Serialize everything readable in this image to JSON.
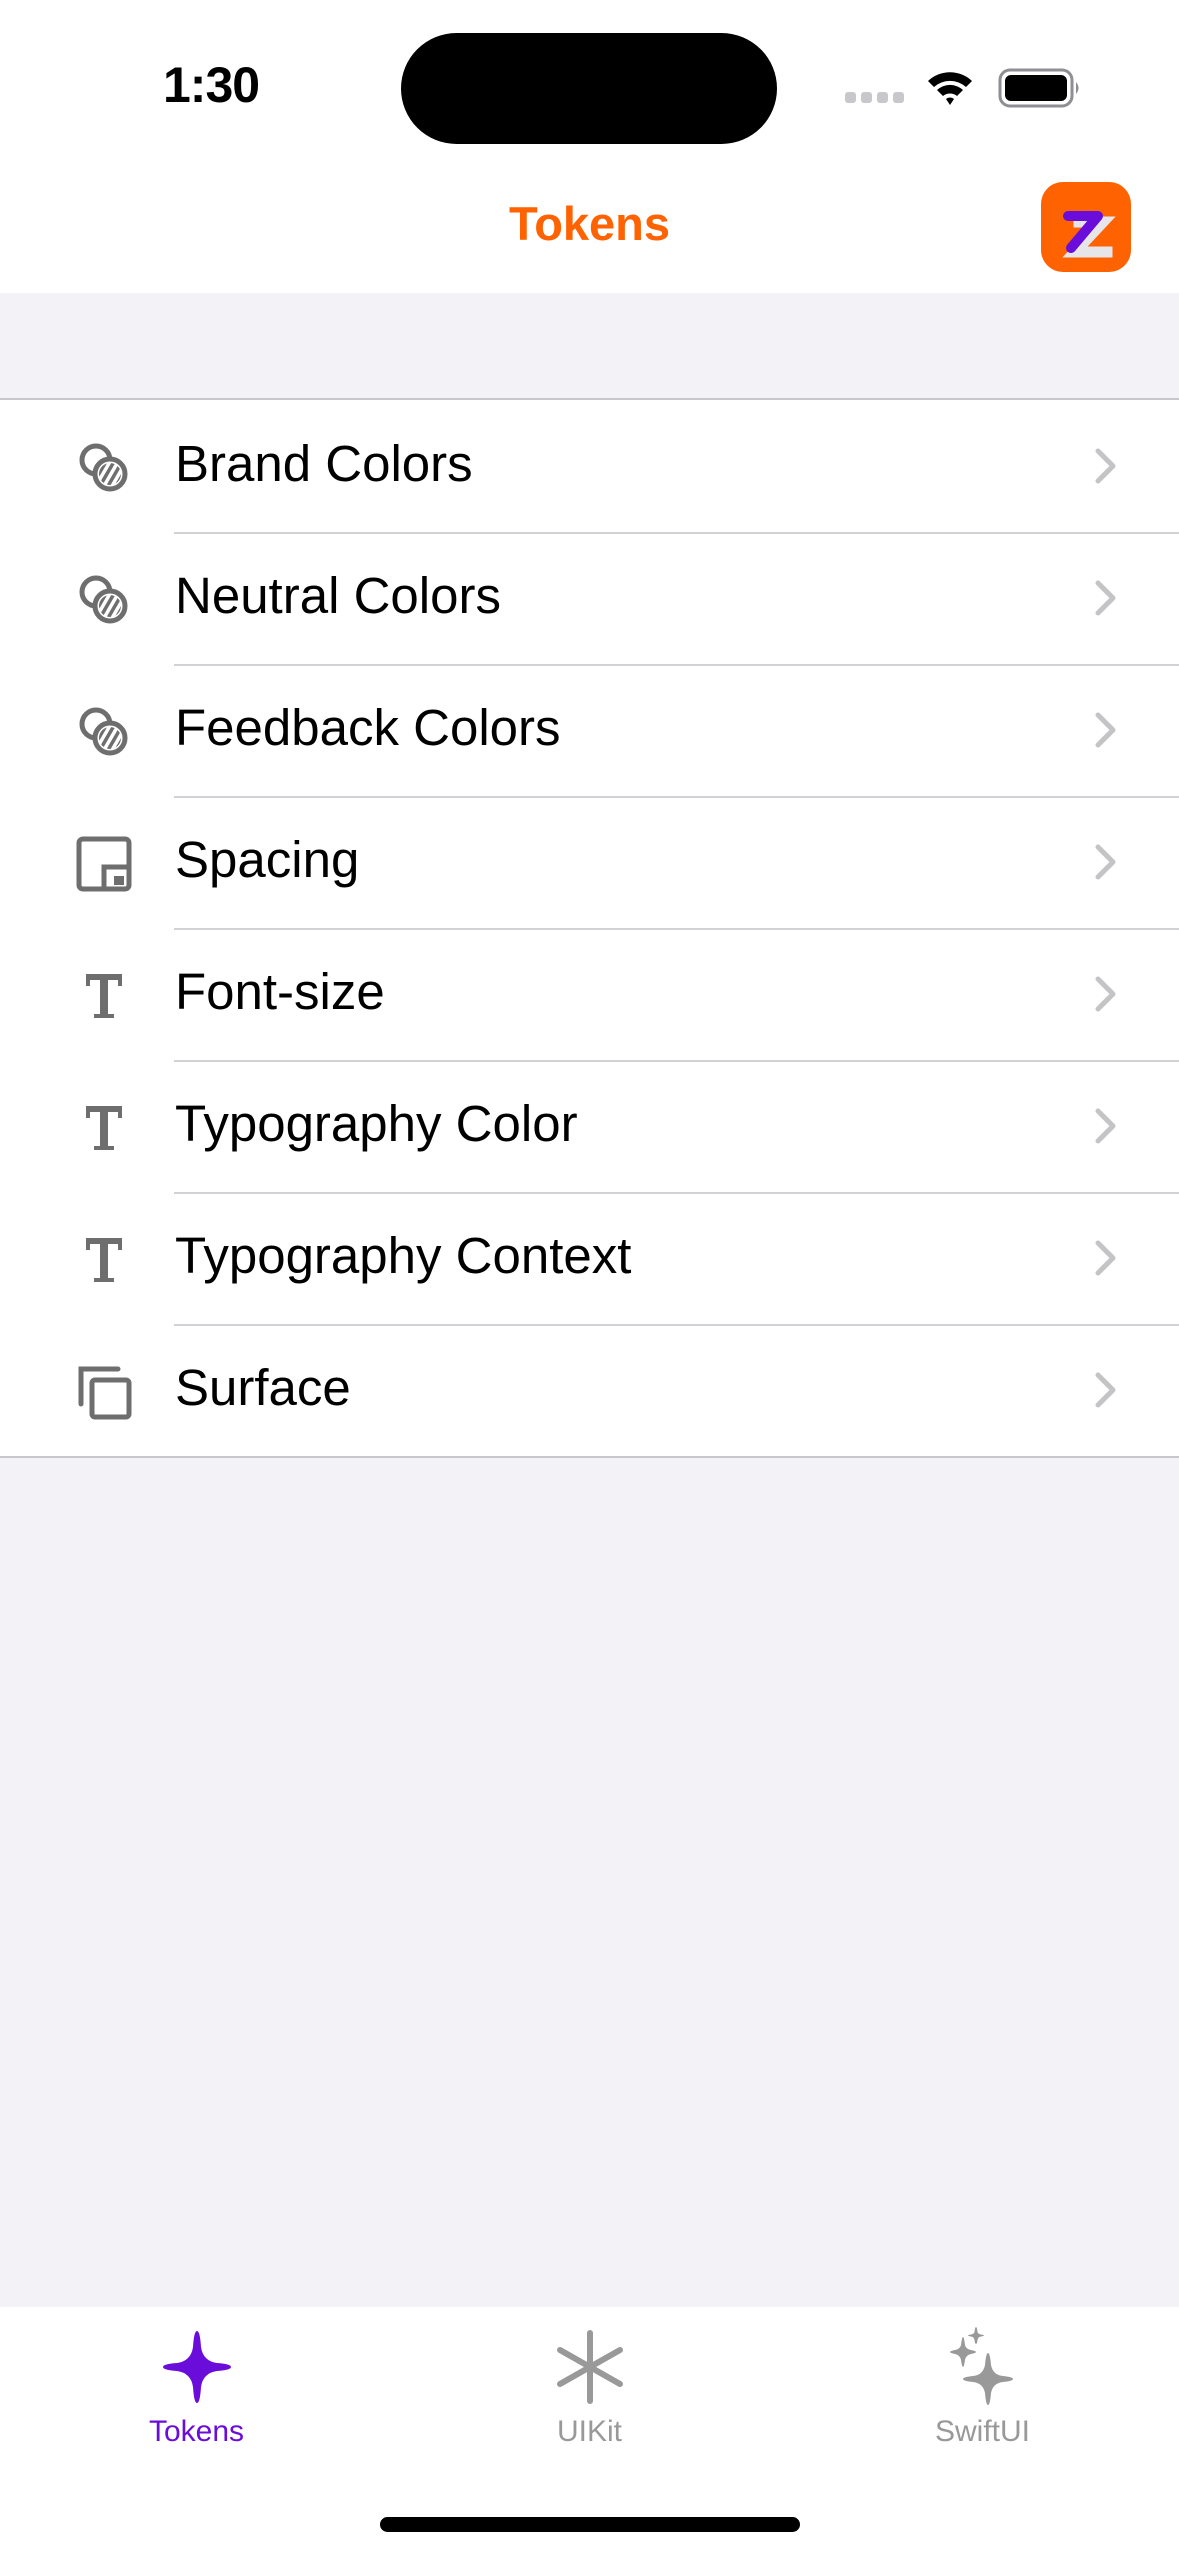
{
  "status_bar": {
    "time": "1:30",
    "signal_icon": "cellular-signal-icon",
    "wifi_icon": "wifi-icon",
    "battery_icon": "battery-full-icon"
  },
  "nav": {
    "title": "Tokens",
    "app_logo_icon": "z-logo-icon"
  },
  "list": {
    "items": [
      {
        "label": "Brand Colors",
        "icon": "color-swatches-icon"
      },
      {
        "label": "Neutral Colors",
        "icon": "color-swatches-icon"
      },
      {
        "label": "Feedback Colors",
        "icon": "color-swatches-icon"
      },
      {
        "label": "Spacing",
        "icon": "spacing-square-icon"
      },
      {
        "label": "Font-size",
        "icon": "text-t-icon"
      },
      {
        "label": "Typography Color",
        "icon": "text-t-icon"
      },
      {
        "label": "Typography Context",
        "icon": "text-t-icon"
      },
      {
        "label": "Surface",
        "icon": "layered-squares-icon"
      }
    ]
  },
  "tabbar": {
    "tabs": [
      {
        "label": "Tokens",
        "icon": "sparkle-icon",
        "active": true
      },
      {
        "label": "UIKit",
        "icon": "asterisk-icon",
        "active": false
      },
      {
        "label": "SwiftUI",
        "icon": "sparkles-icon",
        "active": false
      }
    ]
  },
  "colors": {
    "accent_orange": "#FF6200",
    "accent_purple": "#6A0DDB",
    "logo_light": "#E5E5EA",
    "icon_gray": "#6E6E6E",
    "chevron_gray": "#C4C4C7",
    "tab_inactive": "#999999",
    "background": "#F2F2F7"
  }
}
